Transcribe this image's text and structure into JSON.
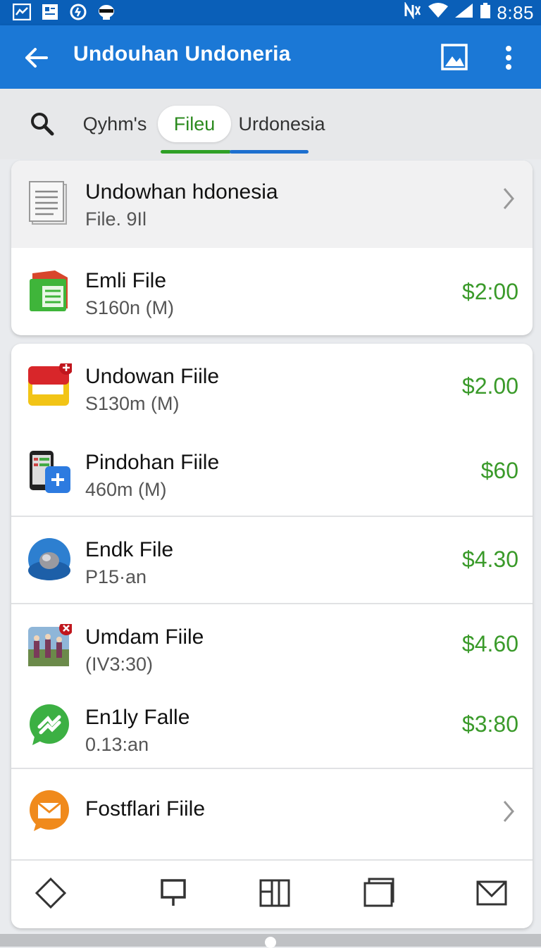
{
  "status_bar": {
    "time": "8:85"
  },
  "app_bar": {
    "title": "Undouhan Undoneria"
  },
  "tabs": [
    {
      "label": "Qyhm's"
    },
    {
      "label": "Fileu"
    },
    {
      "label": "Urdonesia"
    }
  ],
  "colors": {
    "app_bar": "#1b78d6",
    "status_bar": "#0a5fb8",
    "price_green": "#3a9a2a",
    "tab_active": "#2b8a1e",
    "tab_underline_blue": "#1c6fcf"
  },
  "card1": {
    "rows": [
      {
        "title": "Undowhan hdonesia",
        "subtitle": "File. 9Il",
        "icon": "document-icon"
      },
      {
        "title": "Emli File",
        "subtitle": "S160n (M)",
        "price": "$2:00",
        "icon": "green-folder-icon"
      }
    ]
  },
  "card2": {
    "rows": [
      {
        "title": "Undowan Fiile",
        "subtitle": "S130m (M)",
        "price": "$2.00",
        "icon": "flag-icon"
      },
      {
        "title": "Pindohan Fiile",
        "subtitle": "460m (M)",
        "price": "$60",
        "icon": "phone-add-icon"
      },
      {
        "title": "Endk File",
        "subtitle": "P15·an",
        "price": "$4.30",
        "icon": "globe-icon"
      },
      {
        "title": "Umdam Fiile",
        "subtitle": "(IV3:30)",
        "price": "$4.60",
        "icon": "photo-icon"
      },
      {
        "title": "En1ly Falle",
        "subtitle": "0.13:an",
        "price": "$3:80",
        "icon": "chat-icon"
      },
      {
        "title": "Fostflari Fiile",
        "icon": "mail-icon"
      }
    ]
  },
  "bottom_nav": [
    {
      "icon": "diamond-icon"
    },
    {
      "icon": "pin-icon"
    },
    {
      "icon": "columns-icon"
    },
    {
      "icon": "window-icon"
    },
    {
      "icon": "mail-icon"
    }
  ]
}
